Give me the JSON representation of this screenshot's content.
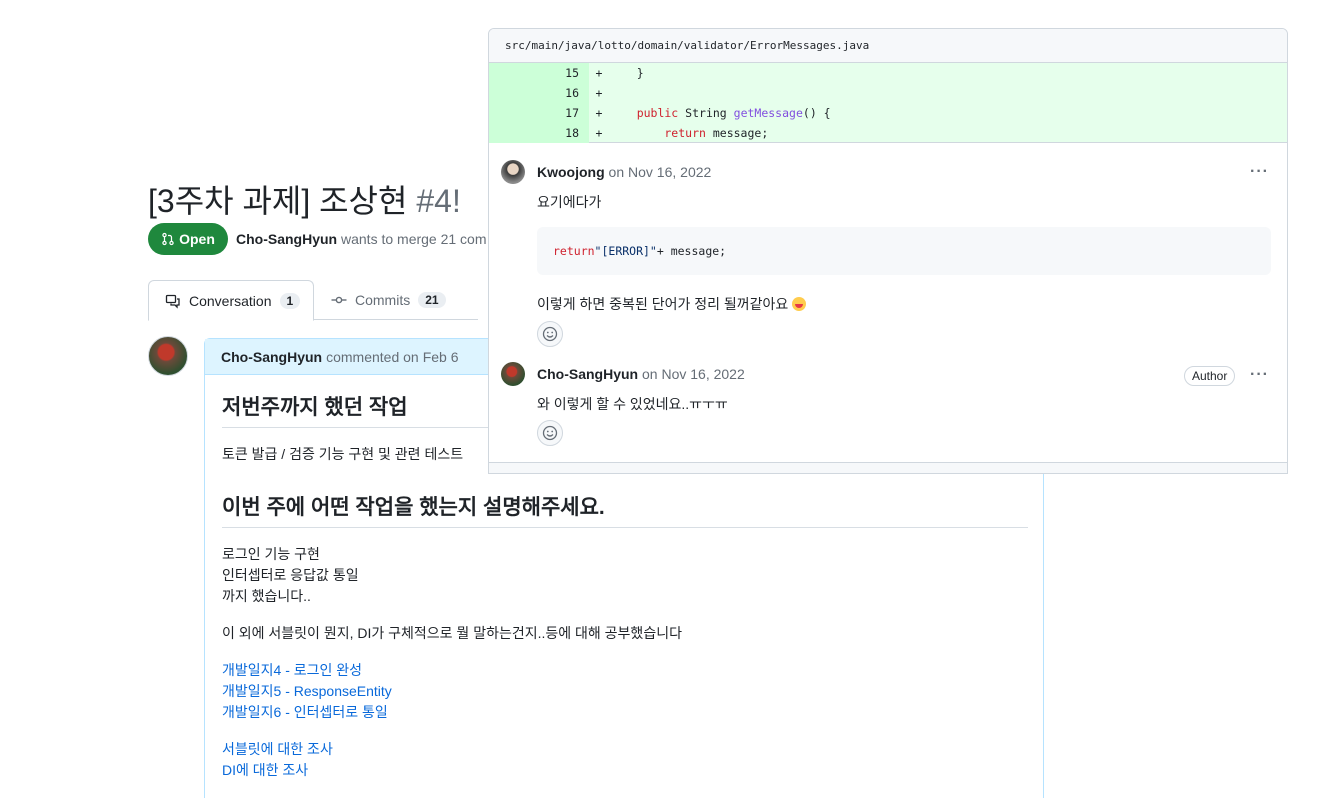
{
  "pr": {
    "title": "[3주차 과제] 조상현 ",
    "number": "#4!",
    "state": "Open",
    "author": "Cho-SangHyun",
    "meta_rest": " wants to merge 21 com"
  },
  "tabs": {
    "conversation": {
      "label": "Conversation",
      "count": "1"
    },
    "commits": {
      "label": "Commits",
      "count": "21"
    }
  },
  "comment": {
    "author": "Cho-SangHyun",
    "action": "commented on",
    "date": "Feb 6",
    "heading1": "저번주까지 했던 작업",
    "line1": "토큰 발급 / 검증 기능 구현 및 관련 테스트",
    "heading2": "이번 주에 어떤 작업을 했는지 설명해주세요.",
    "lines": [
      "로그인 기능 구현",
      "인터셉터로 응답값 통일",
      "까지 했습니다.."
    ],
    "extra": "이 외에 서블릿이 뭔지, DI가 구체적으로 뭘 말하는건지..등에 대해 공부했습니다",
    "links1": [
      "개발일지4 - 로그인 완성",
      "개발일지5 - ResponseEntity",
      "개발일지6 - 인터셉터로 통일"
    ],
    "links2": [
      "서블릿에 대한 조사",
      "DI에 대한 조사"
    ]
  },
  "review": {
    "file_path": "src/main/java/lotto/domain/validator/ErrorMessages.java",
    "diff": [
      {
        "line": "15",
        "sign": "+",
        "code": "    }"
      },
      {
        "line": "16",
        "sign": "+",
        "code": ""
      },
      {
        "line": "17",
        "sign": "+",
        "kw": "    public",
        "mid": " String ",
        "fn": "getMessage",
        "tail": "() {"
      },
      {
        "line": "18",
        "sign": "+",
        "kw": "        return",
        "mid": " message;",
        "fn": "",
        "tail": ""
      }
    ],
    "comment1": {
      "author": "Kwoojong",
      "date_prefix": "on",
      "date": "Nov 16, 2022",
      "text": "요기에다가",
      "code_kw": "return",
      "code_str": " \"[ERROR]\"",
      "code_rest": " + message;",
      "text2": "이렇게 하면 중복된 단어가 정리 될꺼같아요 "
    },
    "comment2": {
      "author": "Cho-SangHyun",
      "date_prefix": "on",
      "date": "Nov 16, 2022",
      "badge": "Author",
      "text": "와 이렇게 할 수 있었네요..ㅠㅜㅠ"
    },
    "kebab": "···"
  },
  "colors": {
    "open_green": "#1f883d",
    "link_blue": "#0969da",
    "diff_add": "#e6ffec",
    "header_blue": "#ddf4ff"
  }
}
